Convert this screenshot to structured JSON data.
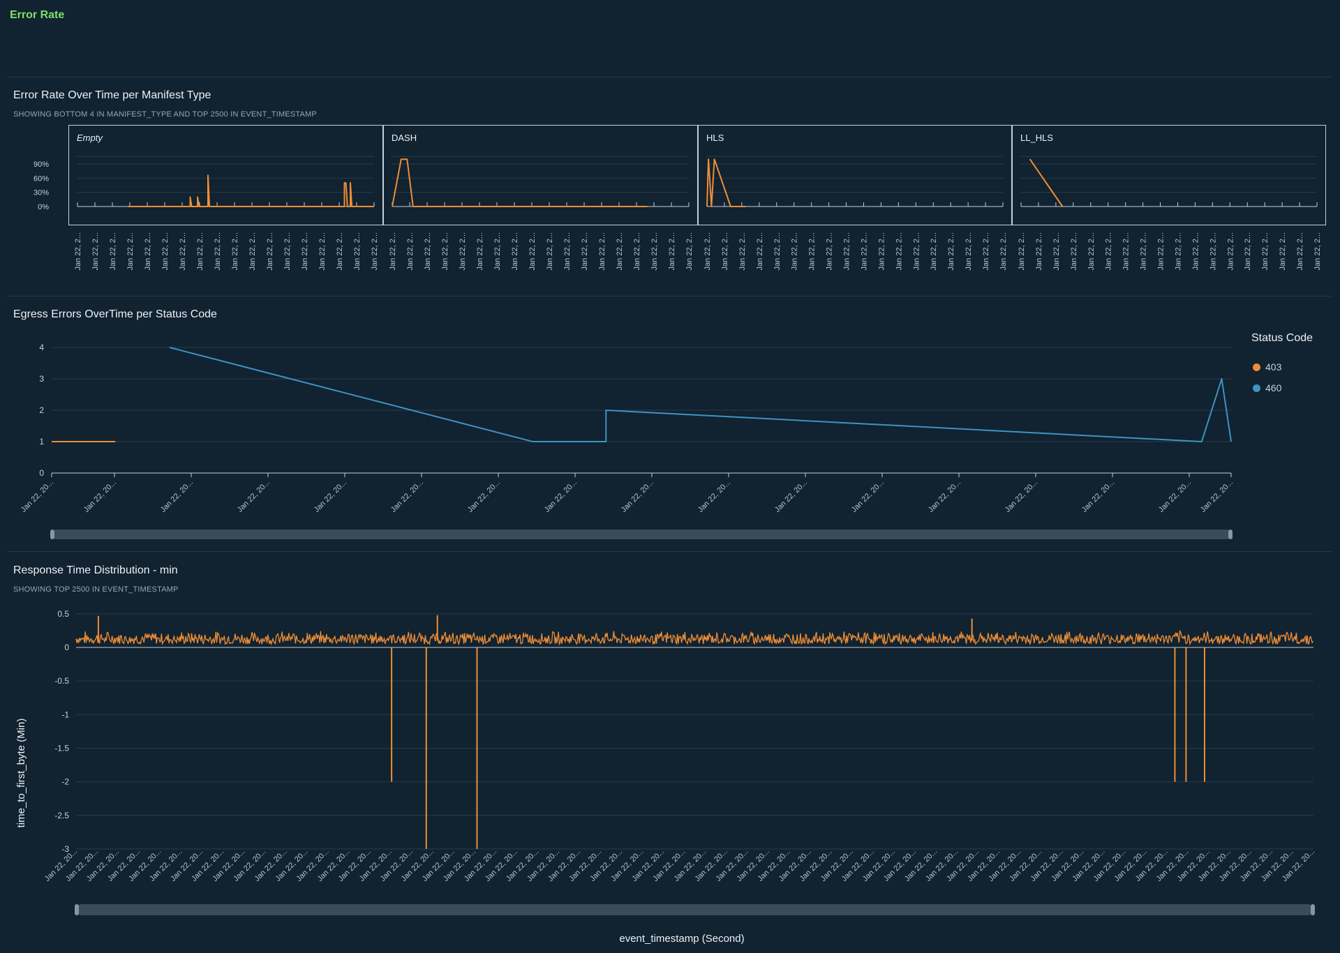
{
  "section_title": "Error Rate",
  "colors": {
    "orange": "#ef8e35",
    "blue": "#3f93c2",
    "section_green": "#7ee06a",
    "background": "#112230"
  },
  "panel1": {
    "title": "Error Rate Over Time per Manifest Type",
    "subtitle": "SHOWING BOTTOM 4 IN MANIFEST_TYPE AND TOP 2500 IN EVENT_TIMESTAMP"
  },
  "panel2": {
    "title": "Egress Errors OverTime per Status Code",
    "legend_title": "Status Code",
    "legend": [
      {
        "label": "403",
        "color": "#ef8e35"
      },
      {
        "label": "460",
        "color": "#3f93c2"
      }
    ]
  },
  "panel3": {
    "title": "Response Time Distribution - min",
    "subtitle": "SHOWING TOP 2500 IN EVENT_TIMESTAMP",
    "ylabel": "time_to_first_byte (Min)",
    "xlabel": "event_timestamp (Second)"
  },
  "chart_data": [
    {
      "type": "line",
      "title": "Error Rate Over Time per Manifest Type",
      "subtitle": "SHOWING BOTTOM 4 IN MANIFEST_TYPE AND TOP 2500 IN EVENT_TIMESTAMP",
      "y_ticks": [
        "90%",
        "60%",
        "30%",
        "0%"
      ],
      "ylim": [
        0,
        100
      ],
      "x_tick_label": "Jan 22, 2...",
      "facets": [
        {
          "name": "Empty",
          "italic": true,
          "xlim": [
            0,
            100
          ],
          "line": [
            [
              17,
              0
            ],
            [
              38,
              0
            ],
            [
              38,
              20
            ],
            [
              38.5,
              0
            ],
            [
              40.5,
              0
            ],
            [
              40.5,
              20
            ],
            [
              41,
              0
            ],
            [
              44,
              0
            ],
            [
              44,
              66
            ],
            [
              44.5,
              0
            ],
            [
              90,
              0
            ],
            [
              90,
              50
            ],
            [
              90.5,
              50
            ],
            [
              91,
              0
            ],
            [
              92,
              0
            ],
            [
              92,
              50
            ],
            [
              92.5,
              0
            ],
            [
              100,
              0
            ]
          ]
        },
        {
          "name": "DASH",
          "italic": false,
          "xlim": [
            0,
            100
          ],
          "line": [
            [
              0,
              0
            ],
            [
              3,
              100
            ],
            [
              5,
              100
            ],
            [
              7,
              0
            ],
            [
              86,
              0
            ]
          ]
        },
        {
          "name": "HLS",
          "italic": false,
          "xlim": [
            0,
            100
          ],
          "line": [
            [
              0,
              0
            ],
            [
              0.5,
              100
            ],
            [
              1.5,
              0
            ],
            [
              2.5,
              100
            ],
            [
              8,
              0
            ],
            [
              13,
              0
            ]
          ]
        },
        {
          "name": "LL_HLS",
          "italic": false,
          "xlim": [
            0,
            100
          ],
          "line": [
            [
              3,
              100
            ],
            [
              14,
              0
            ]
          ]
        }
      ]
    },
    {
      "type": "line",
      "title": "Egress Errors OverTime per Status Code",
      "legend_title": "Status Code",
      "ylim": [
        0,
        4
      ],
      "y_ticks": [
        0,
        1,
        2,
        3,
        4
      ],
      "x_tick_label": "Jan 22, 20...",
      "series": [
        {
          "name": "403",
          "color": "#ef8e35",
          "points": [
            [
              0,
              1
            ],
            [
              5.4,
              1
            ]
          ]
        },
        {
          "name": "460",
          "color": "#3f93c2",
          "points": [
            [
              10,
              4
            ],
            [
              40.8,
              1
            ],
            [
              47,
              1
            ],
            [
              47,
              2
            ],
            [
              97.5,
              1
            ],
            [
              99.2,
              3
            ],
            [
              100,
              1
            ]
          ]
        }
      ]
    },
    {
      "type": "line",
      "title": "Response Time Distribution - min",
      "subtitle": "SHOWING TOP 2500 IN EVENT_TIMESTAMP",
      "ylabel": "time_to_first_byte (Min)",
      "xlabel": "event_timestamp (Second)",
      "ylim": [
        -3,
        0.5
      ],
      "y_ticks": [
        "0.5",
        "0",
        "-0.5",
        "-1",
        "-1.5",
        "-2",
        "-2.5",
        "-3"
      ],
      "x_tick_label": "Jan 22, 20...",
      "series": [
        {
          "name": "",
          "color": "#ef8e35",
          "baseline_band": [
            0.05,
            0.25
          ],
          "spikes_down": [
            [
              25.5,
              -2
            ],
            [
              28.3,
              -3
            ],
            [
              32.4,
              -3
            ],
            [
              88.8,
              -2
            ],
            [
              89.7,
              -2
            ],
            [
              91.2,
              -2
            ]
          ],
          "spikes_up": [
            [
              1.8,
              0.47
            ],
            [
              29.2,
              0.48
            ],
            [
              72.4,
              0.43
            ]
          ]
        }
      ]
    }
  ]
}
